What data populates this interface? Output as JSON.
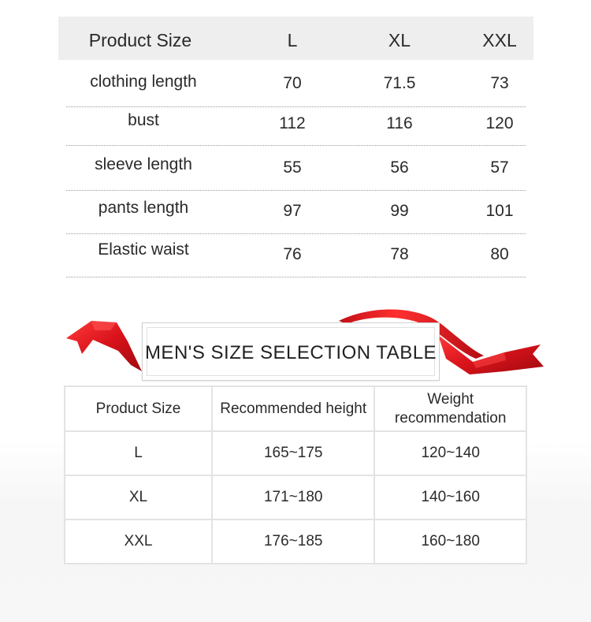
{
  "size_table": {
    "headers": [
      "Product Size",
      "L",
      "XL",
      "XXL"
    ],
    "rows": [
      {
        "label": "clothing length",
        "values": [
          "70",
          "71.5",
          "73"
        ]
      },
      {
        "label": "bust",
        "values": [
          "112",
          "116",
          "120"
        ]
      },
      {
        "label": "sleeve length",
        "values": [
          "55",
          "56",
          "57"
        ]
      },
      {
        "label": "pants length",
        "values": [
          "97",
          "99",
          "101"
        ]
      },
      {
        "label": "Elastic waist",
        "values": [
          "76",
          "78",
          "80"
        ]
      }
    ]
  },
  "banner": {
    "title": "MEN'S SIZE SELECTION TABLE",
    "ribbon_color": "#d8121a"
  },
  "selection_table": {
    "headers": [
      "Product Size",
      "Recommended height",
      "Weight recommendation"
    ],
    "rows": [
      [
        "L",
        "165~175",
        "120~140"
      ],
      [
        "XL",
        "171~180",
        "140~160"
      ],
      [
        "XXL",
        "176~185",
        "160~180"
      ]
    ]
  }
}
